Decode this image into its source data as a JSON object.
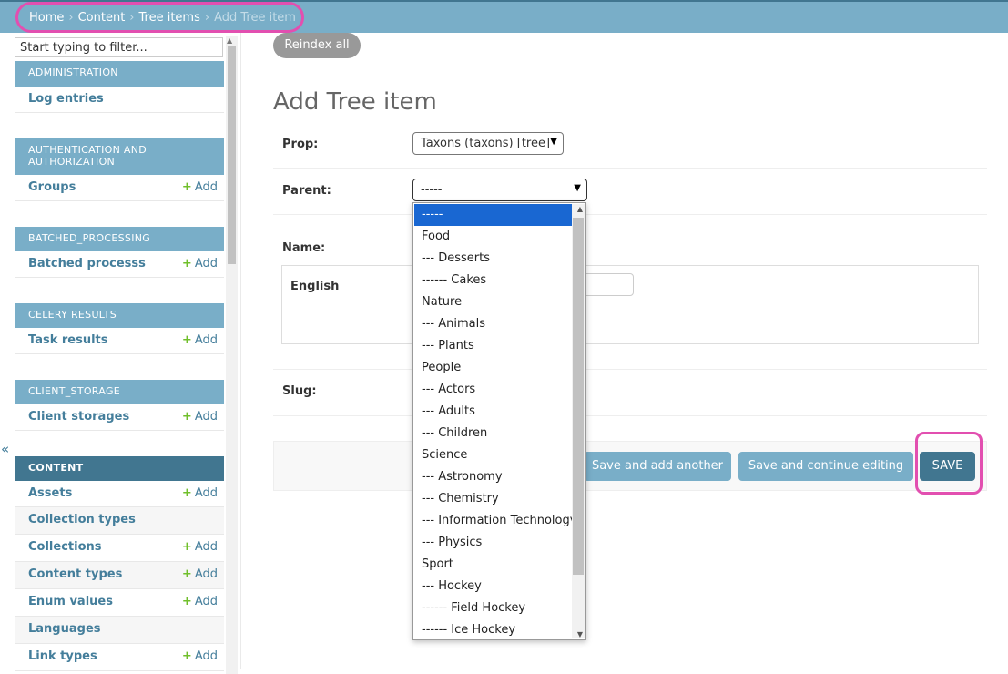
{
  "breadcrumbs": {
    "home": "Home",
    "content": "Content",
    "tree_items": "Tree items",
    "current": "Add Tree item",
    "sep": "›"
  },
  "sidebar": {
    "filter_placeholder": "Start typing to filter...",
    "collapse_glyph": "«",
    "add_label": "Add",
    "modules": [
      {
        "caption": "ADMINISTRATION",
        "items": [
          {
            "label": "Log entries",
            "add": false
          }
        ]
      },
      {
        "caption": "AUTHENTICATION AND AUTHORIZATION",
        "items": [
          {
            "label": "Groups",
            "add": true
          }
        ]
      },
      {
        "caption": "BATCHED_PROCESSING",
        "items": [
          {
            "label": "Batched processs",
            "add": true
          }
        ]
      },
      {
        "caption": "CELERY RESULTS",
        "items": [
          {
            "label": "Task results",
            "add": true
          }
        ]
      },
      {
        "caption": "CLIENT_STORAGE",
        "items": [
          {
            "label": "Client storages",
            "add": true
          }
        ]
      },
      {
        "caption": "CONTENT",
        "current": true,
        "items": [
          {
            "label": "Assets",
            "add": true
          },
          {
            "label": "Collection types",
            "add": false
          },
          {
            "label": "Collections",
            "add": true
          },
          {
            "label": "Content types",
            "add": true
          },
          {
            "label": "Enum values",
            "add": true
          },
          {
            "label": "Languages",
            "add": false
          },
          {
            "label": "Link types",
            "add": true
          }
        ]
      }
    ]
  },
  "main": {
    "reindex_label": "Reindex all",
    "title": "Add Tree item",
    "prop_label": "Prop:",
    "prop_value": "Taxons (taxons) [tree]",
    "parent_label": "Parent:",
    "parent_value": "-----",
    "name_label": "Name:",
    "english_label": "English",
    "slug_label": "Slug:",
    "buttons": {
      "save_add_another": "Save and add another",
      "save_continue": "Save and continue editing",
      "save": "SAVE"
    }
  },
  "dropdown_options": [
    "-----",
    "Food",
    "--- Desserts",
    "------ Cakes",
    "Nature",
    "--- Animals",
    "--- Plants",
    "People",
    "--- Actors",
    "--- Adults",
    "--- Children",
    "Science",
    "--- Astronomy",
    "--- Chemistry",
    "--- Information Technology",
    "--- Physics",
    "Sport",
    "--- Hockey",
    "------ Field Hockey",
    "------ Ice Hockey"
  ],
  "dropdown_selected_index": 0,
  "colors": {
    "header": "#79aec8",
    "module_current": "#417690",
    "link": "#447e9b",
    "add_plus": "#70bf2b",
    "option_selected": "#1967d2",
    "highlight": "#e24fb0"
  }
}
